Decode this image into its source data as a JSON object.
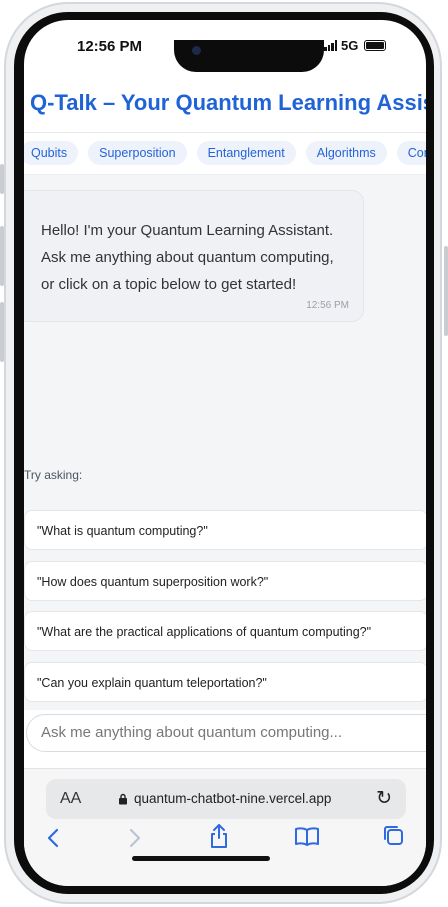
{
  "status_bar": {
    "time": "12:56 PM",
    "network": "5G"
  },
  "app": {
    "title": "Q-Talk – Your Quantum Learning Assistant"
  },
  "topics": [
    "Qubits",
    "Superposition",
    "Entanglement",
    "Algorithms",
    "Computing"
  ],
  "chat": {
    "message": "Hello! I'm your Quantum Learning Assistant. Ask me anything about quantum computing, or click on a topic below to get started!",
    "message_time": "12:56 PM"
  },
  "suggestions": {
    "label": "Try asking:",
    "items": [
      "\"What is quantum computing?\"",
      "\"How does quantum superposition work?\"",
      "\"What are the practical applications of quantum computing?\"",
      "\"Can you explain quantum teleportation?\""
    ]
  },
  "input": {
    "placeholder": "Ask me anything about quantum computing..."
  },
  "browser": {
    "text_size_label": "AA",
    "url": "quantum-chatbot-nine.vercel.app",
    "icons": [
      "back-icon",
      "forward-icon",
      "share-icon",
      "bookmarks-icon",
      "tabs-icon",
      "reload-icon",
      "lock-icon"
    ]
  },
  "colors": {
    "accent": "#1f63d6",
    "chip_bg": "#eef2fb",
    "chat_bg": "#f4f5f7",
    "safari_blue": "#2f6ae0"
  }
}
